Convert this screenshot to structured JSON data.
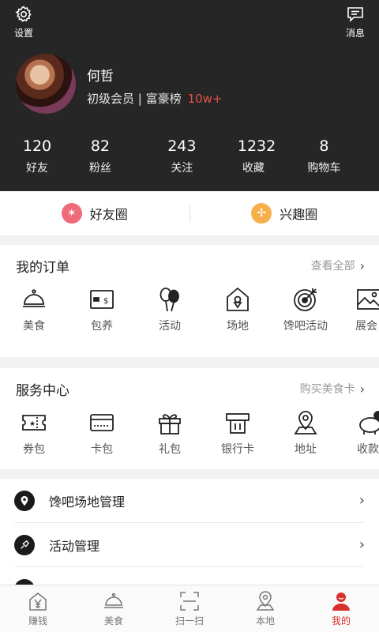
{
  "header": {
    "settings_label": "设置",
    "messages_label": "消息",
    "user_name": "何哲",
    "user_level": "初级会员 | 富豪榜",
    "user_rank": "10w+",
    "stats": [
      {
        "num": "120",
        "label": "好友"
      },
      {
        "num": "82",
        "label": "粉丝"
      },
      {
        "num": "243",
        "label": "关注"
      },
      {
        "num": "1232",
        "label": "收藏"
      },
      {
        "num": "8",
        "label": "购物车"
      }
    ]
  },
  "circles": [
    {
      "label": "好友圈",
      "icon": "star-badge-icon",
      "color": "#ef6b7a"
    },
    {
      "label": "兴趣圈",
      "icon": "pinwheel-icon",
      "color": "#f5b04a"
    }
  ],
  "orders": {
    "title": "我的订单",
    "more": "查看全部",
    "items": [
      "美食",
      "包养",
      "活动",
      "场地",
      "馋吧活动",
      "展会"
    ]
  },
  "services": {
    "title": "服务中心",
    "more": "购买美食卡",
    "items": [
      "券包",
      "卡包",
      "礼包",
      "银行卡",
      "地址",
      "收款"
    ]
  },
  "management": [
    {
      "label": "馋吧场地管理",
      "icon": "location-pin-icon"
    },
    {
      "label": "活动管理",
      "icon": "badminton-icon"
    }
  ],
  "nav": [
    {
      "label": "赚钱",
      "icon": "yen-house-icon"
    },
    {
      "label": "美食",
      "icon": "cloche-icon"
    },
    {
      "label": "扫一扫",
      "icon": "scan-icon"
    },
    {
      "label": "本地",
      "icon": "map-pin-icon"
    },
    {
      "label": "我的",
      "icon": "profile-icon",
      "active": true
    }
  ],
  "colors": {
    "accent": "#d9302c",
    "header_bg": "#262626",
    "rank_red": "#e8504a"
  }
}
